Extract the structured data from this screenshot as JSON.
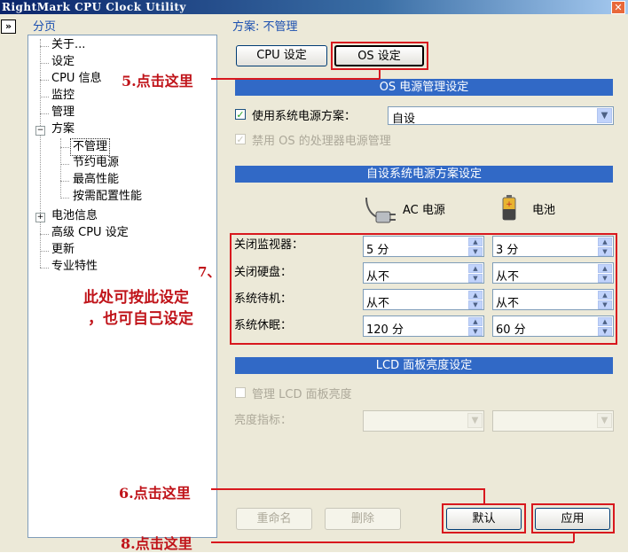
{
  "window": {
    "title": "RightMark CPU Clock Utility",
    "close_glyph": "✕"
  },
  "nav": {
    "collapse_glyph": "»",
    "panel_title": "分页",
    "items": {
      "about": "关于...",
      "settings": "设定",
      "cpu_info": "CPU 信息",
      "monitor": "监控",
      "manage": "管理",
      "schemes": "方案",
      "no_manage": "不管理",
      "power_save": "节约电源",
      "max_perf": "最高性能",
      "on_demand": "按需配置性能",
      "battery_info": "电池信息",
      "advanced_cpu": "高级 CPU 设定",
      "update": "更新",
      "pro_features": "专业特性"
    },
    "expand_minus": "−",
    "expand_plus": "+"
  },
  "main": {
    "scheme_title": "方案: 不管理",
    "tabs": {
      "cpu": "CPU 设定",
      "os": "OS 设定"
    },
    "os_power_section": "OS 电源管理设定",
    "use_system_scheme_label": "使用系统电源方案：",
    "use_system_scheme_checked": true,
    "scheme_select_value": "自设",
    "disable_os_processor_label": "禁用 OS 的处理器电源管理",
    "custom_scheme_section": "自设系统电源方案设定",
    "ac_label": "AC 电源",
    "battery_label": "电池",
    "rows": [
      {
        "label": "关闭监视器：",
        "ac": "5 分",
        "battery": "3 分"
      },
      {
        "label": "关闭硬盘：",
        "ac": "从不",
        "battery": "从不"
      },
      {
        "label": "系统待机：",
        "ac": "从不",
        "battery": "从不"
      },
      {
        "label": "系统休眠：",
        "ac": "120 分",
        "battery": "60 分"
      }
    ],
    "lcd_section": "LCD 面板亮度设定",
    "manage_lcd_label": "管理 LCD 面板亮度",
    "brightness_label": "亮度指标：",
    "buttons": {
      "rename": "重命名",
      "delete": "删除",
      "default": "默认",
      "apply": "应用"
    }
  },
  "annotations": {
    "step5": "5.点击这里",
    "step6": "6.点击这里",
    "step7_num": "7、",
    "step7_line1": "此处可按此设定",
    "step7_line2": "，也可自己设定",
    "step8": "8.点击这里"
  },
  "colors": {
    "section_bar": "#3169c6",
    "annotation_red": "#d8181e",
    "title_blue": "#1a4fb0"
  }
}
